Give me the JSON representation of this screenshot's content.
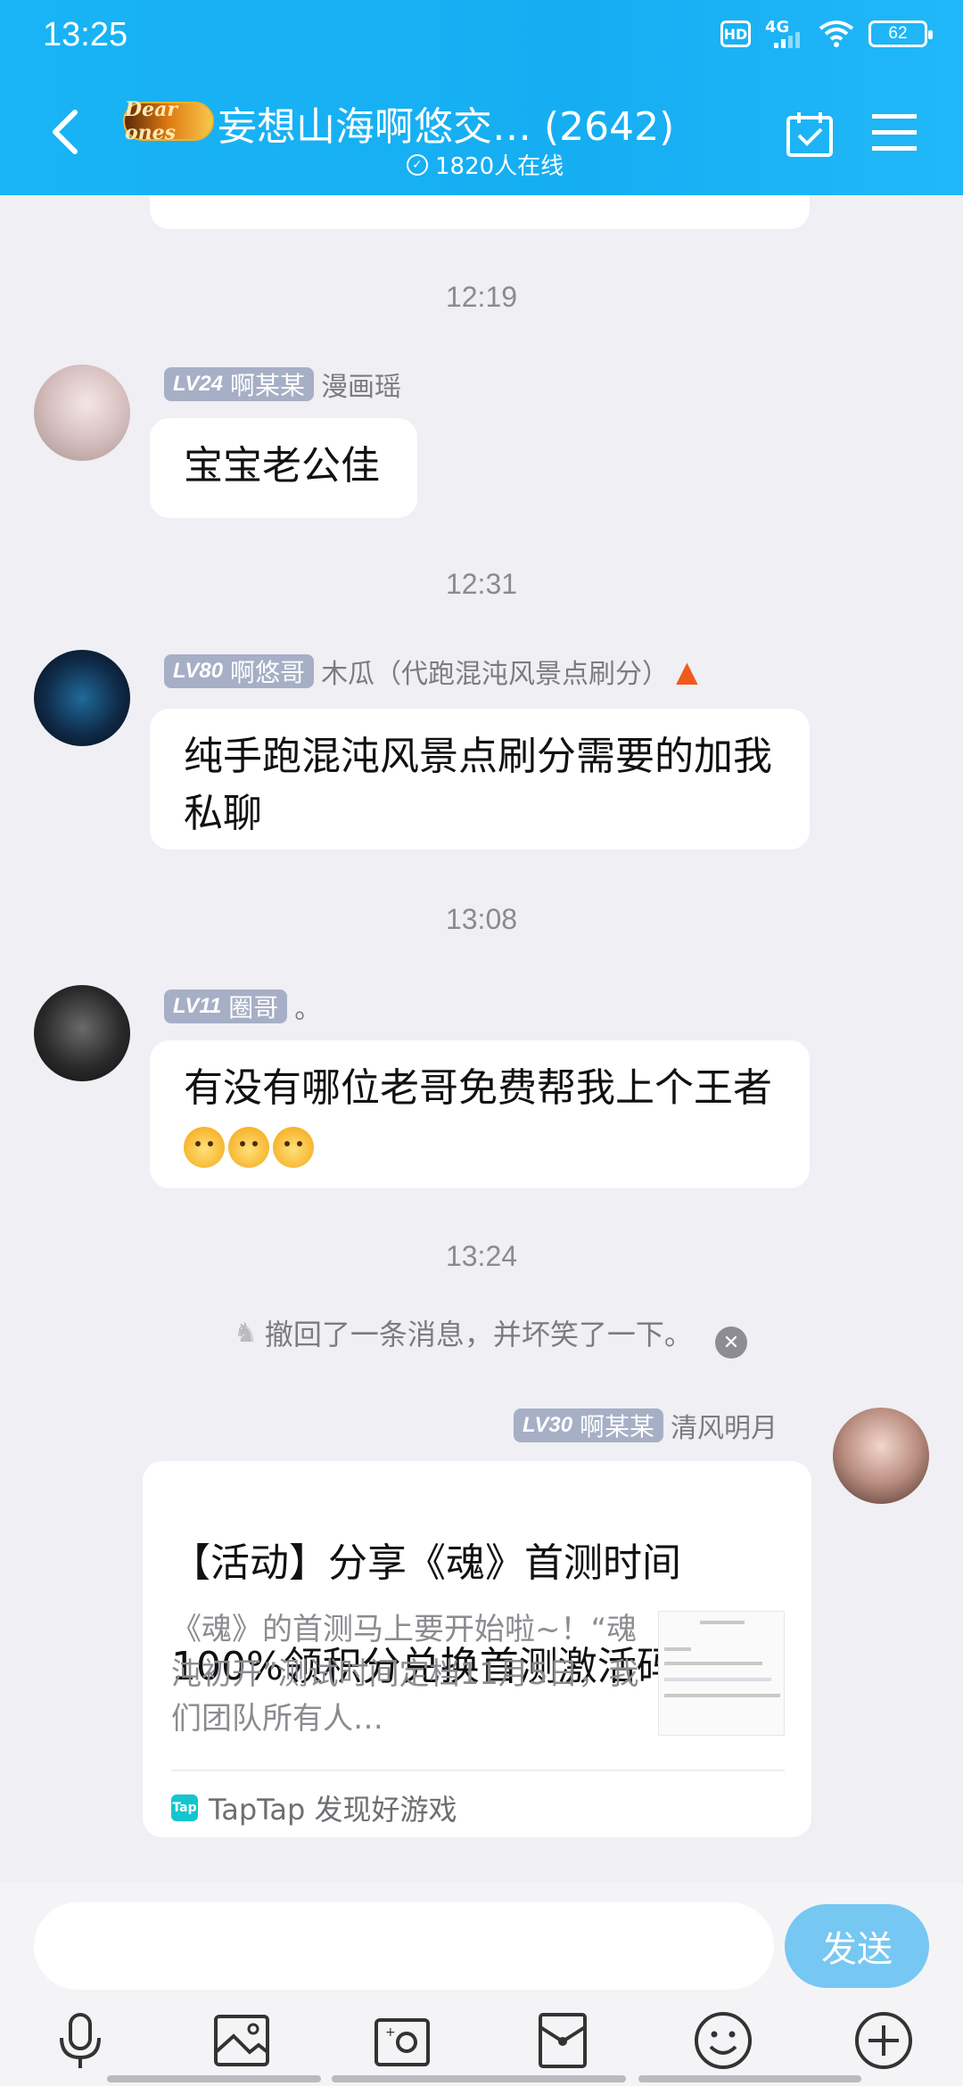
{
  "status_bar": {
    "time": "13:25",
    "hd": "HD",
    "network": "4G",
    "battery": "62"
  },
  "header": {
    "back_icon": "chevron-left-icon",
    "group_logo_text": "Dear ones",
    "group_title": "妄想山海啊悠交… (2642)",
    "online_count": "1820人在线",
    "calendar_icon": "calendar-check-icon",
    "menu_icon": "hamburger-menu-icon"
  },
  "messages": [
    {
      "timestamp": "12:19",
      "level": "LV24",
      "title": "啊某某",
      "nickname": "漫画瑶",
      "text": "宝宝老公佳"
    },
    {
      "timestamp": "12:31",
      "level": "LV80",
      "title": "啊悠哥",
      "nickname": "木瓜（代跑混沌风景点刷分）",
      "text": "纯手跑混沌风景点刷分需要的加我私聊"
    },
    {
      "timestamp": "13:08",
      "level": "LV11",
      "title": "圈哥",
      "nickname": "。",
      "text": "有没有哪位老哥免费帮我上个王者"
    }
  ],
  "recall": {
    "timestamp": "13:24",
    "text": "撤回了一条消息，并坏笑了一下。"
  },
  "share_card": {
    "level": "LV30",
    "title": "啊某某",
    "nickname": "清风明月",
    "card_title_line1": "【活动】分享《魂》首测时间",
    "card_title_line2": "100%领积分兑换首测激活码 -…",
    "card_body": "《魂》的首测马上要开始啦~！“魂沌初开”测试时间定档11月5日，我们团队所有人…",
    "source_icon_text": "Tap",
    "source": "TapTap 发现好游戏"
  },
  "input_bar": {
    "placeholder": "",
    "send_label": "发送",
    "tools": [
      "microphone-icon",
      "image-icon",
      "camera-icon",
      "red-packet-icon",
      "emoji-icon",
      "plus-icon"
    ]
  },
  "colors": {
    "header": "#18b2f4",
    "level_badge": "#a7afc6",
    "send_button": "#77c7f3",
    "chat_background": "#efeff4"
  }
}
